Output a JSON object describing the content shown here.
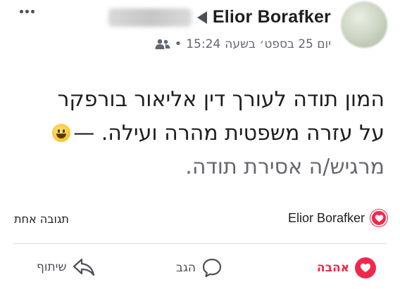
{
  "header": {
    "author_name": "Elior Borafker",
    "timestamp": "יום 25 בספט׳ בשעה",
    "time": "15:24",
    "meta_separator": "•"
  },
  "post": {
    "line1": "המון תודה לעורך דין אליאור בורפקר",
    "line2": "על עזרה משפטית מהרה ועילה. —",
    "line3": "מרגיש/ה אסירת תודה."
  },
  "summary": {
    "reactor_name": "Elior Borafker",
    "comment_count": "תגובה אחת"
  },
  "actions": {
    "love_label": "אהבה",
    "comment_label": "הגב",
    "share_label": "שיתוף"
  },
  "colors": {
    "love": "#f0284a",
    "text": "#1c1e21",
    "muted": "#606770"
  },
  "icons": [
    "more-icon",
    "arrow-icon",
    "friends-icon",
    "smiley-emoji-icon",
    "heart-icon",
    "comment-icon",
    "share-icon"
  ]
}
